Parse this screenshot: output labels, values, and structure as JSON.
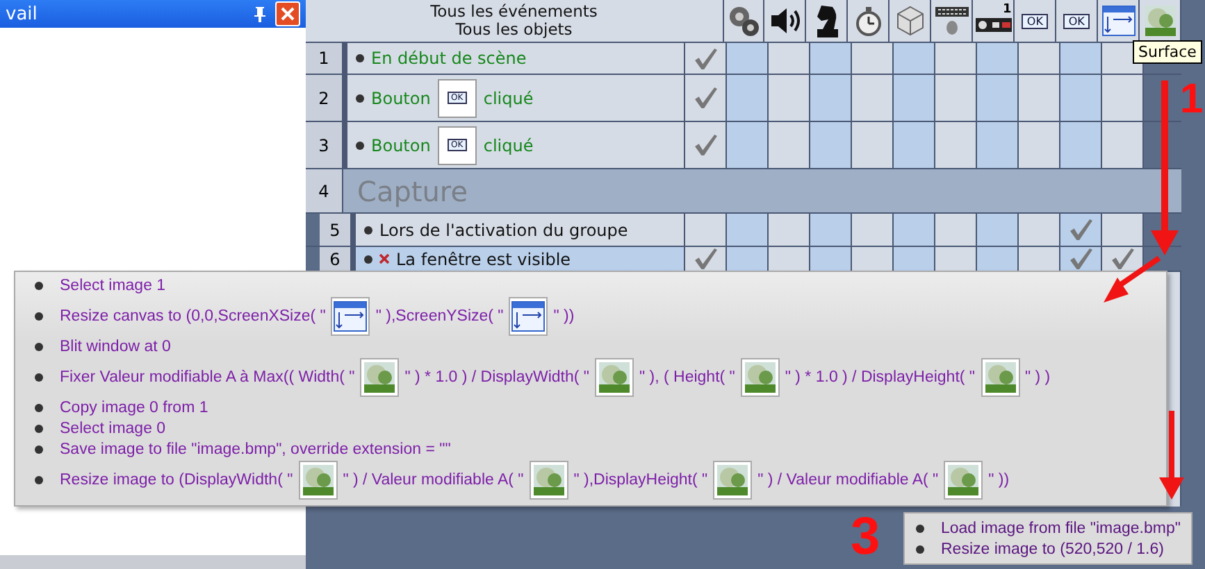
{
  "panel": {
    "title": "vail"
  },
  "header": {
    "line1": "Tous les événements",
    "line2": "Tous les objets"
  },
  "object_columns": [
    {
      "kind": "gears"
    },
    {
      "kind": "speaker"
    },
    {
      "kind": "knight"
    },
    {
      "kind": "stopwatch"
    },
    {
      "kind": "cube"
    },
    {
      "kind": "keyboard"
    },
    {
      "kind": "gamepad",
      "badge": "1"
    },
    {
      "kind": "button",
      "label": "OK"
    },
    {
      "kind": "button",
      "label": "OK"
    },
    {
      "kind": "frame"
    },
    {
      "kind": "picture"
    }
  ],
  "tooltip": "Surface",
  "events": [
    {
      "number": "1",
      "kind": "event",
      "selected": false,
      "conditions": [
        {
          "negated": false,
          "parts": [
            {
              "kind": "text",
              "text": "En début de scène"
            }
          ]
        }
      ],
      "checks": [
        true,
        false,
        false,
        false,
        false,
        false,
        false,
        false,
        false,
        false,
        false
      ]
    },
    {
      "number": "2",
      "kind": "event",
      "selected": false,
      "conditions": [
        {
          "negated": false,
          "parts": [
            {
              "kind": "text",
              "text": "Bouton"
            },
            {
              "kind": "button-object",
              "label": "OK"
            },
            {
              "kind": "text",
              "text": "cliqué"
            }
          ]
        }
      ],
      "checks": [
        true,
        false,
        false,
        false,
        false,
        false,
        false,
        false,
        false,
        false,
        false
      ]
    },
    {
      "number": "3",
      "kind": "event",
      "selected": false,
      "conditions": [
        {
          "negated": false,
          "parts": [
            {
              "kind": "text",
              "text": "Bouton"
            },
            {
              "kind": "button-object",
              "label": "OK"
            },
            {
              "kind": "text",
              "text": "cliqué"
            }
          ]
        }
      ],
      "checks": [
        true,
        false,
        false,
        false,
        false,
        false,
        false,
        false,
        false,
        false,
        false
      ]
    },
    {
      "number": "4",
      "kind": "group",
      "title": "Capture"
    },
    {
      "number": "5",
      "kind": "group-event",
      "selected": false,
      "conditions": [
        {
          "negated": false,
          "parts": [
            {
              "kind": "text",
              "text": "Lors de l'activation du groupe"
            }
          ]
        }
      ],
      "checks": [
        false,
        false,
        false,
        false,
        false,
        false,
        false,
        false,
        false,
        true,
        false
      ]
    },
    {
      "number": "6",
      "kind": "group-event",
      "selected": true,
      "conditions": [
        {
          "negated": true,
          "parts": [
            {
              "kind": "text",
              "text": "La fenêtre est visible"
            }
          ]
        }
      ],
      "checks": [
        true,
        false,
        false,
        false,
        false,
        false,
        false,
        false,
        false,
        true,
        true
      ]
    }
  ],
  "actions_popup": [
    {
      "parts": [
        {
          "kind": "text",
          "text": "Select image 1"
        }
      ]
    },
    {
      "parts": [
        {
          "kind": "text",
          "text": "Resize canvas to (0,0,ScreenXSize( \""
        },
        {
          "kind": "frame-object"
        },
        {
          "kind": "text",
          "text": "\" ),ScreenYSize( \""
        },
        {
          "kind": "frame-object"
        },
        {
          "kind": "text",
          "text": "\" ))"
        }
      ]
    },
    {
      "parts": [
        {
          "kind": "text",
          "text": "Blit window at 0"
        }
      ]
    },
    {
      "parts": [
        {
          "kind": "text",
          "text": "Fixer Valeur modifiable A à Max(( Width( \""
        },
        {
          "kind": "picture-object"
        },
        {
          "kind": "text",
          "text": "\" ) * 1.0 ) / DisplayWidth( \""
        },
        {
          "kind": "picture-object"
        },
        {
          "kind": "text",
          "text": "\" ), ( Height( \""
        },
        {
          "kind": "picture-object"
        },
        {
          "kind": "text",
          "text": "\" ) * 1.0 ) / DisplayHeight( \""
        },
        {
          "kind": "picture-object"
        },
        {
          "kind": "text",
          "text": "\" ) )"
        }
      ]
    },
    {
      "parts": [
        {
          "kind": "text",
          "text": "Copy image 0 from 1"
        }
      ]
    },
    {
      "parts": [
        {
          "kind": "text",
          "text": "Select image 0"
        }
      ]
    },
    {
      "parts": [
        {
          "kind": "text",
          "text": "Save image to file \"image.bmp\", override extension = \"\""
        }
      ]
    },
    {
      "parts": [
        {
          "kind": "text",
          "text": "Resize image to (DisplayWidth( \""
        },
        {
          "kind": "picture-object"
        },
        {
          "kind": "text",
          "text": "\" ) / Valeur modifiable A( \""
        },
        {
          "kind": "picture-object"
        },
        {
          "kind": "text",
          "text": "\" ),DisplayHeight( \""
        },
        {
          "kind": "picture-object"
        },
        {
          "kind": "text",
          "text": "\" ) / Valeur modifiable A( \""
        },
        {
          "kind": "picture-object"
        },
        {
          "kind": "text",
          "text": "\" ))"
        }
      ]
    }
  ],
  "small_popup": [
    {
      "parts": [
        {
          "kind": "text",
          "text": "Load image from file \"image.bmp\""
        }
      ]
    },
    {
      "parts": [
        {
          "kind": "text",
          "text": "Resize image to (520,520 / 1.6)"
        }
      ]
    }
  ],
  "annotations": [
    {
      "text": "1"
    },
    {
      "text": "3"
    }
  ]
}
